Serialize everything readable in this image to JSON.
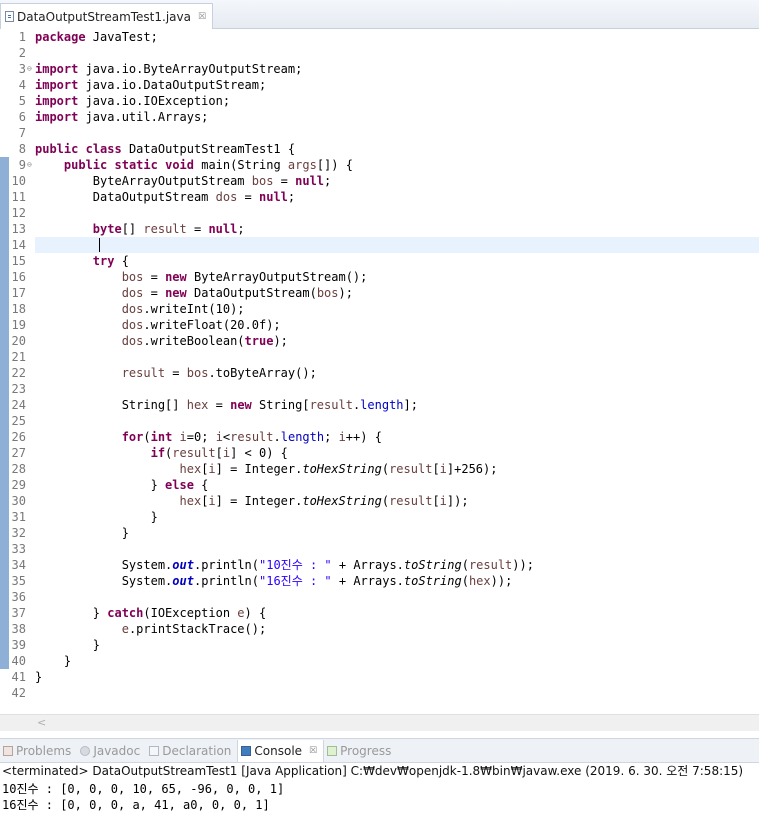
{
  "editor_tab": {
    "title": "DataOutputStreamTest1.java",
    "close": "☒"
  },
  "code_lines": [
    {
      "n": "1",
      "fold": "",
      "tokens": [
        {
          "t": "package",
          "c": "kw"
        },
        {
          "t": " JavaTest;"
        }
      ]
    },
    {
      "n": "2",
      "fold": "",
      "tokens": []
    },
    {
      "n": "3",
      "fold": "⊖",
      "tokens": [
        {
          "t": "import",
          "c": "kw"
        },
        {
          "t": " java.io.ByteArrayOutputStream;"
        }
      ]
    },
    {
      "n": "4",
      "fold": "",
      "tokens": [
        {
          "t": "import",
          "c": "kw"
        },
        {
          "t": " java.io.DataOutputStream;"
        }
      ]
    },
    {
      "n": "5",
      "fold": "",
      "tokens": [
        {
          "t": "import",
          "c": "kw"
        },
        {
          "t": " java.io.IOException;"
        }
      ]
    },
    {
      "n": "6",
      "fold": "",
      "tokens": [
        {
          "t": "import",
          "c": "kw"
        },
        {
          "t": " java.util.Arrays;"
        }
      ]
    },
    {
      "n": "7",
      "fold": "",
      "tokens": []
    },
    {
      "n": "8",
      "fold": "",
      "tokens": [
        {
          "t": "public",
          "c": "kw"
        },
        {
          "t": " "
        },
        {
          "t": "class",
          "c": "kw"
        },
        {
          "t": " DataOutputStreamTest1 {"
        }
      ]
    },
    {
      "n": "9",
      "fold": "⊖",
      "marker": true,
      "tokens": [
        {
          "t": "    "
        },
        {
          "t": "public",
          "c": "kw"
        },
        {
          "t": " "
        },
        {
          "t": "static",
          "c": "kw"
        },
        {
          "t": " "
        },
        {
          "t": "void",
          "c": "kw"
        },
        {
          "t": " main(String "
        },
        {
          "t": "args",
          "c": "var"
        },
        {
          "t": "[]) {"
        }
      ]
    },
    {
      "n": "10",
      "fold": "",
      "marker": true,
      "tokens": [
        {
          "t": "        ByteArrayOutputStream "
        },
        {
          "t": "bos",
          "c": "var"
        },
        {
          "t": " = "
        },
        {
          "t": "null",
          "c": "kw"
        },
        {
          "t": ";"
        }
      ]
    },
    {
      "n": "11",
      "fold": "",
      "marker": true,
      "tokens": [
        {
          "t": "        DataOutputStream "
        },
        {
          "t": "dos",
          "c": "var"
        },
        {
          "t": " = "
        },
        {
          "t": "null",
          "c": "kw"
        },
        {
          "t": ";"
        }
      ]
    },
    {
      "n": "12",
      "fold": "",
      "marker": true,
      "tokens": []
    },
    {
      "n": "13",
      "fold": "",
      "marker": true,
      "tokens": [
        {
          "t": "        "
        },
        {
          "t": "byte",
          "c": "kw"
        },
        {
          "t": "[] "
        },
        {
          "t": "result",
          "c": "var"
        },
        {
          "t": " = "
        },
        {
          "t": "null",
          "c": "kw"
        },
        {
          "t": ";"
        }
      ]
    },
    {
      "n": "14",
      "fold": "",
      "marker": true,
      "current": true,
      "tokens": []
    },
    {
      "n": "15",
      "fold": "",
      "marker": true,
      "tokens": [
        {
          "t": "        "
        },
        {
          "t": "try",
          "c": "kw"
        },
        {
          "t": " {"
        }
      ]
    },
    {
      "n": "16",
      "fold": "",
      "marker": true,
      "tokens": [
        {
          "t": "            "
        },
        {
          "t": "bos",
          "c": "var"
        },
        {
          "t": " = "
        },
        {
          "t": "new",
          "c": "kw"
        },
        {
          "t": " ByteArrayOutputStream();"
        }
      ]
    },
    {
      "n": "17",
      "fold": "",
      "marker": true,
      "tokens": [
        {
          "t": "            "
        },
        {
          "t": "dos",
          "c": "var"
        },
        {
          "t": " = "
        },
        {
          "t": "new",
          "c": "kw"
        },
        {
          "t": " DataOutputStream("
        },
        {
          "t": "bos",
          "c": "var"
        },
        {
          "t": ");"
        }
      ]
    },
    {
      "n": "18",
      "fold": "",
      "marker": true,
      "tokens": [
        {
          "t": "            "
        },
        {
          "t": "dos",
          "c": "var"
        },
        {
          "t": ".writeInt(10);"
        }
      ]
    },
    {
      "n": "19",
      "fold": "",
      "marker": true,
      "tokens": [
        {
          "t": "            "
        },
        {
          "t": "dos",
          "c": "var"
        },
        {
          "t": ".writeFloat(20.0f);"
        }
      ]
    },
    {
      "n": "20",
      "fold": "",
      "marker": true,
      "tokens": [
        {
          "t": "            "
        },
        {
          "t": "dos",
          "c": "var"
        },
        {
          "t": ".writeBoolean("
        },
        {
          "t": "true",
          "c": "kw"
        },
        {
          "t": ");"
        }
      ]
    },
    {
      "n": "21",
      "fold": "",
      "marker": true,
      "tokens": []
    },
    {
      "n": "22",
      "fold": "",
      "marker": true,
      "tokens": [
        {
          "t": "            "
        },
        {
          "t": "result",
          "c": "var"
        },
        {
          "t": " = "
        },
        {
          "t": "bos",
          "c": "var"
        },
        {
          "t": ".toByteArray();"
        }
      ]
    },
    {
      "n": "23",
      "fold": "",
      "marker": true,
      "tokens": []
    },
    {
      "n": "24",
      "fold": "",
      "marker": true,
      "tokens": [
        {
          "t": "            String[] "
        },
        {
          "t": "hex",
          "c": "var"
        },
        {
          "t": " = "
        },
        {
          "t": "new",
          "c": "kw"
        },
        {
          "t": " String["
        },
        {
          "t": "result",
          "c": "var"
        },
        {
          "t": "."
        },
        {
          "t": "length",
          "c": "fld"
        },
        {
          "t": "];"
        }
      ]
    },
    {
      "n": "25",
      "fold": "",
      "marker": true,
      "tokens": []
    },
    {
      "n": "26",
      "fold": "",
      "marker": true,
      "tokens": [
        {
          "t": "            "
        },
        {
          "t": "for",
          "c": "kw"
        },
        {
          "t": "("
        },
        {
          "t": "int",
          "c": "kw"
        },
        {
          "t": " "
        },
        {
          "t": "i",
          "c": "var"
        },
        {
          "t": "=0; "
        },
        {
          "t": "i",
          "c": "var"
        },
        {
          "t": "<"
        },
        {
          "t": "result",
          "c": "var"
        },
        {
          "t": "."
        },
        {
          "t": "length",
          "c": "fld"
        },
        {
          "t": "; "
        },
        {
          "t": "i",
          "c": "var"
        },
        {
          "t": "++) {"
        }
      ]
    },
    {
      "n": "27",
      "fold": "",
      "marker": true,
      "tokens": [
        {
          "t": "                "
        },
        {
          "t": "if",
          "c": "kw"
        },
        {
          "t": "("
        },
        {
          "t": "result",
          "c": "var"
        },
        {
          "t": "["
        },
        {
          "t": "i",
          "c": "var"
        },
        {
          "t": "] < 0) {"
        }
      ]
    },
    {
      "n": "28",
      "fold": "",
      "marker": true,
      "tokens": [
        {
          "t": "                    "
        },
        {
          "t": "hex",
          "c": "var"
        },
        {
          "t": "["
        },
        {
          "t": "i",
          "c": "var"
        },
        {
          "t": "] = Integer."
        },
        {
          "t": "toHexString",
          "c": "smeth"
        },
        {
          "t": "("
        },
        {
          "t": "result",
          "c": "var"
        },
        {
          "t": "["
        },
        {
          "t": "i",
          "c": "var"
        },
        {
          "t": "]+256);"
        }
      ]
    },
    {
      "n": "29",
      "fold": "",
      "marker": true,
      "tokens": [
        {
          "t": "                } "
        },
        {
          "t": "else",
          "c": "kw"
        },
        {
          "t": " {"
        }
      ]
    },
    {
      "n": "30",
      "fold": "",
      "marker": true,
      "tokens": [
        {
          "t": "                    "
        },
        {
          "t": "hex",
          "c": "var"
        },
        {
          "t": "["
        },
        {
          "t": "i",
          "c": "var"
        },
        {
          "t": "] = Integer."
        },
        {
          "t": "toHexString",
          "c": "smeth"
        },
        {
          "t": "("
        },
        {
          "t": "result",
          "c": "var"
        },
        {
          "t": "["
        },
        {
          "t": "i",
          "c": "var"
        },
        {
          "t": "]);"
        }
      ]
    },
    {
      "n": "31",
      "fold": "",
      "marker": true,
      "tokens": [
        {
          "t": "                }"
        }
      ]
    },
    {
      "n": "32",
      "fold": "",
      "marker": true,
      "tokens": [
        {
          "t": "            }"
        }
      ]
    },
    {
      "n": "33",
      "fold": "",
      "marker": true,
      "tokens": []
    },
    {
      "n": "34",
      "fold": "",
      "marker": true,
      "tokens": [
        {
          "t": "            System."
        },
        {
          "t": "out",
          "c": "sfld"
        },
        {
          "t": ".println("
        },
        {
          "t": "\"10진수 : \"",
          "c": "str"
        },
        {
          "t": " + Arrays."
        },
        {
          "t": "toString",
          "c": "smeth"
        },
        {
          "t": "("
        },
        {
          "t": "result",
          "c": "var"
        },
        {
          "t": "));"
        }
      ]
    },
    {
      "n": "35",
      "fold": "",
      "marker": true,
      "tokens": [
        {
          "t": "            System."
        },
        {
          "t": "out",
          "c": "sfld"
        },
        {
          "t": ".println("
        },
        {
          "t": "\"16진수 : \"",
          "c": "str"
        },
        {
          "t": " + Arrays."
        },
        {
          "t": "toString",
          "c": "smeth"
        },
        {
          "t": "("
        },
        {
          "t": "hex",
          "c": "var"
        },
        {
          "t": "));"
        }
      ]
    },
    {
      "n": "36",
      "fold": "",
      "marker": true,
      "tokens": []
    },
    {
      "n": "37",
      "fold": "",
      "marker": true,
      "tokens": [
        {
          "t": "        } "
        },
        {
          "t": "catch",
          "c": "kw"
        },
        {
          "t": "(IOException "
        },
        {
          "t": "e",
          "c": "var"
        },
        {
          "t": ") {"
        }
      ]
    },
    {
      "n": "38",
      "fold": "",
      "marker": true,
      "tokens": [
        {
          "t": "            "
        },
        {
          "t": "e",
          "c": "var"
        },
        {
          "t": ".printStackTrace();"
        }
      ]
    },
    {
      "n": "39",
      "fold": "",
      "marker": true,
      "tokens": [
        {
          "t": "        }"
        }
      ]
    },
    {
      "n": "40",
      "fold": "",
      "marker": true,
      "tokens": [
        {
          "t": "    }"
        }
      ]
    },
    {
      "n": "41",
      "fold": "",
      "tokens": [
        {
          "t": "}"
        }
      ]
    },
    {
      "n": "42",
      "fold": "",
      "tokens": []
    }
  ],
  "scroll_arrow": "<",
  "view_tabs": [
    {
      "label": "Problems",
      "icon": "problems-icon",
      "active": false
    },
    {
      "label": "Javadoc",
      "icon": "javadoc-icon",
      "active": false
    },
    {
      "label": "Declaration",
      "icon": "declaration-icon",
      "active": false
    },
    {
      "label": "Console",
      "icon": "console-icon",
      "active": true,
      "close": "☒"
    },
    {
      "label": "Progress",
      "icon": "progress-icon",
      "active": false
    }
  ],
  "console": {
    "header": "<terminated> DataOutputStreamTest1 [Java Application] C:₩dev₩openjdk-1.8₩bin₩javaw.exe (2019. 6. 30. 오전 7:58:15)",
    "lines": [
      "10진수 : [0, 0, 0, 10, 65, -96, 0, 0, 1]",
      "16진수 : [0, 0, 0, a, 41, a0, 0, 0, 1]"
    ]
  },
  "colors": {
    "keyword": "#7f0055",
    "variable": "#6a3e3e",
    "field": "#0000c0",
    "string": "#2a00ff",
    "current_line": "#e8f2fe",
    "marker": "#8fb0d6"
  }
}
